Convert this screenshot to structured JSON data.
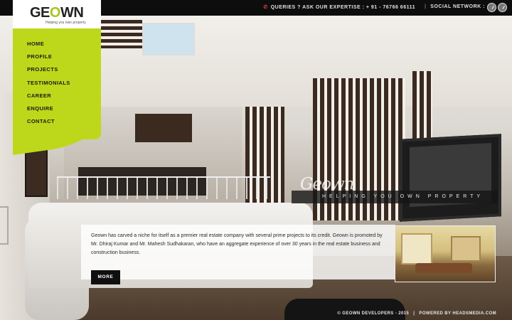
{
  "logo": {
    "text_before": "GE",
    "text_o": "O",
    "text_after": "WN",
    "tagline": "Helping you own property"
  },
  "topbar": {
    "queries_label": "QUERIES ? ASK OUR EXPERTISE : + 91 - 76766 66111",
    "separator": "|",
    "social_label": "SOCIAL NETWORK :",
    "social_icons": [
      "social-icon-1",
      "social-icon-2"
    ]
  },
  "nav": {
    "items": [
      {
        "label": "HOME"
      },
      {
        "label": "PROFILE"
      },
      {
        "label": "PROJECTS"
      },
      {
        "label": "TESTIMONIALS"
      },
      {
        "label": "CAREER"
      },
      {
        "label": "ENQUIRE"
      },
      {
        "label": "CONTACT"
      }
    ]
  },
  "hero": {
    "brand_script": "Geown",
    "tagline": "HELPING YOU OWN PROPERTY"
  },
  "about": {
    "text": "Geown has carved a niche for itself as a premier real estate company with several prime projects to its credit. Geown is promoted by Mr. Dhiraj Kumar and Mr. Mahesh Sudhakaran, who have an aggregate experience of over 30 years in the real estate business and construction business.",
    "more_label": "MORE"
  },
  "footer": {
    "copyright": "© GEOWN DEVELOPERS - 2015",
    "separator": "|",
    "powered": "POWERED BY HEADSMEDIA.COM"
  },
  "colors": {
    "accent": "#bdd81a",
    "topbar": "#0d0d0d",
    "button": "#0f0f0f"
  }
}
